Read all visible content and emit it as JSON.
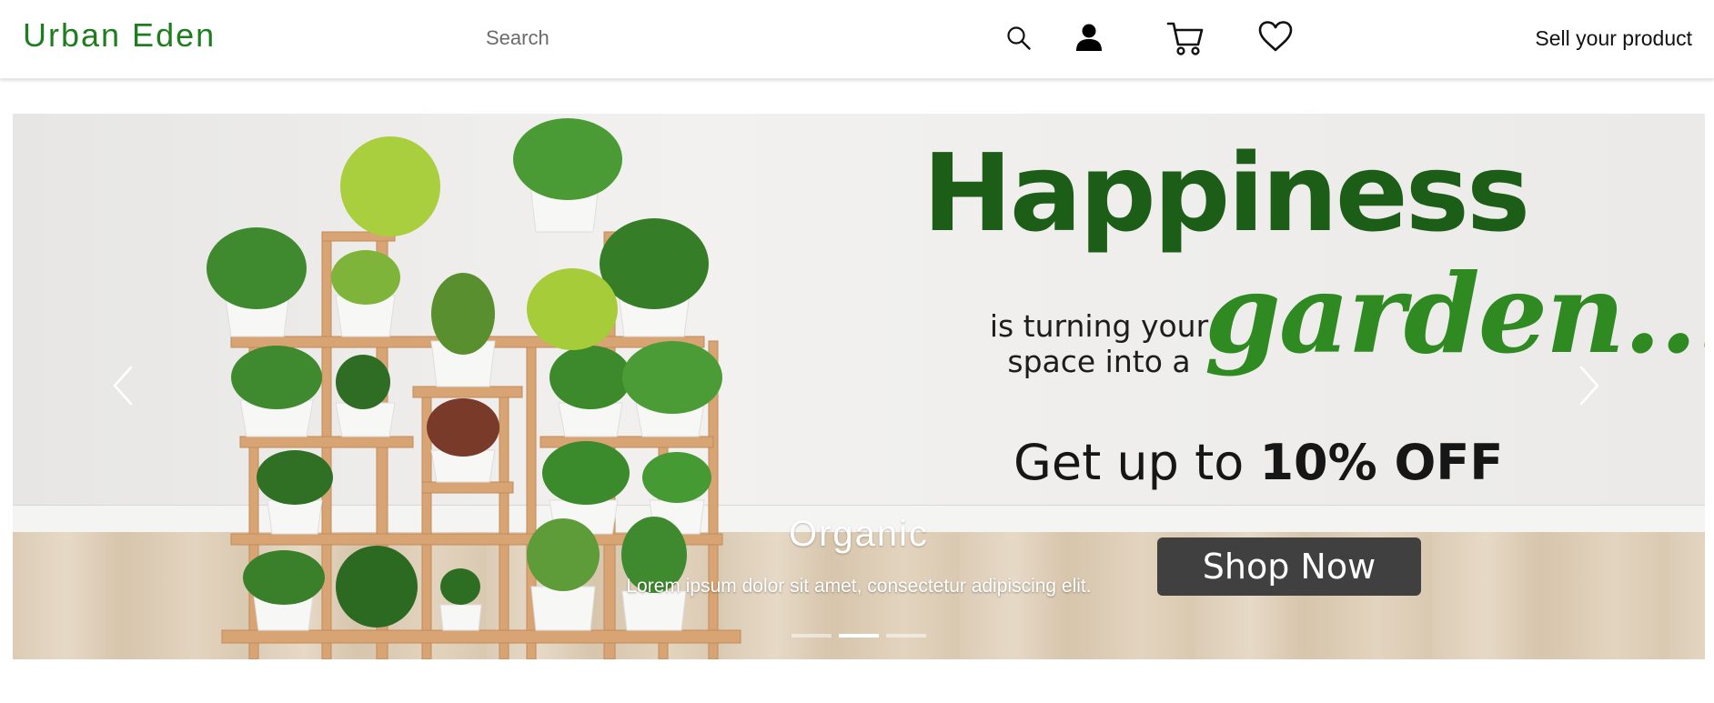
{
  "header": {
    "brand": "Urban Eden",
    "search_placeholder": "Search",
    "sell_link": "Sell your product",
    "icons": [
      "search-icon",
      "user-icon",
      "cart-icon",
      "heart-icon"
    ]
  },
  "carousel": {
    "promo": {
      "headline": "Happiness",
      "line1": "is turning your",
      "line2": "space into a",
      "script_word": "garden...",
      "discount_prefix": "Get up to",
      "discount_value": "10% OFF",
      "button": "Shop Now"
    },
    "caption_title": "Organic",
    "caption_text": "Lorem ipsum dolor sit amet, consectetur adipiscing elit.",
    "slide_count": 3,
    "active_slide": 2,
    "arrows": [
      "chevron-left-icon",
      "chevron-right-icon"
    ]
  },
  "colors": {
    "brand": "#1e7d1e",
    "headline": "#1c5e17",
    "script": "#2f8a22",
    "button": "#404040"
  }
}
